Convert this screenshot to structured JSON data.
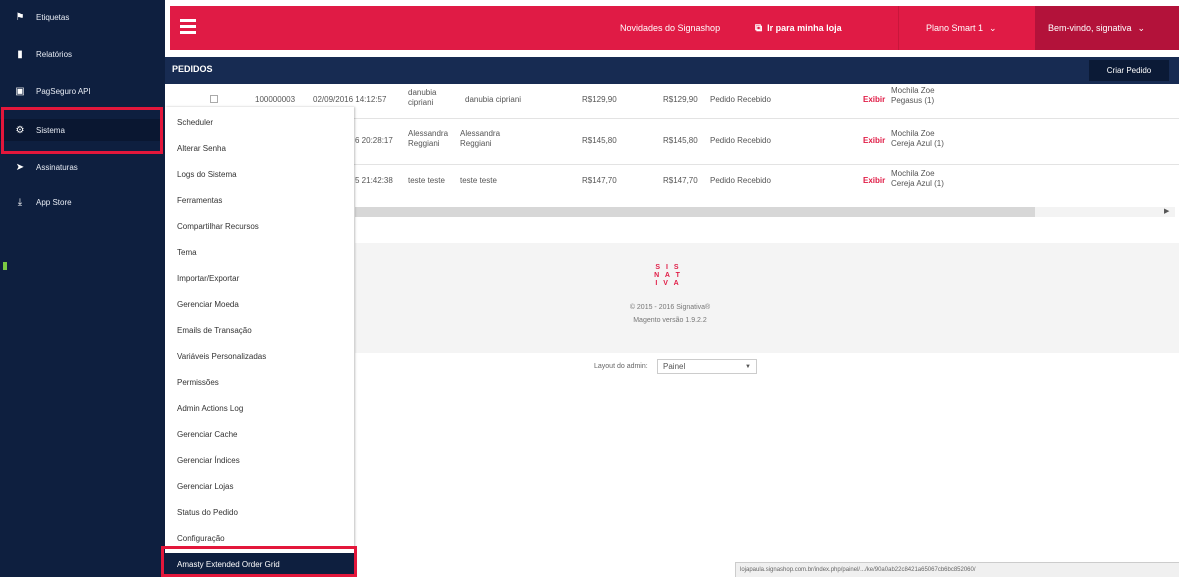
{
  "sidebar": {
    "items": [
      {
        "label": "Etiquetas",
        "icon": "bookmark-icon"
      },
      {
        "label": "Relatórios",
        "icon": "bar-chart-icon"
      },
      {
        "label": "PagSeguro API",
        "icon": "credit-card-icon"
      },
      {
        "label": "Sistema",
        "icon": "gear-icon"
      },
      {
        "label": "Assinaturas",
        "icon": "send-icon"
      },
      {
        "label": "App Store",
        "icon": "download-icon"
      }
    ]
  },
  "topbar": {
    "news": "Novidades do Signashop",
    "store": "Ir para minha loja",
    "plan": "Plano Smart 1",
    "welcome": "Bem-vindo, signativa"
  },
  "title": {
    "text": "PEDIDOS",
    "create_button": "Criar Pedido"
  },
  "orders": {
    "rows": [
      {
        "order_no": "100000003",
        "date": "02/09/2016 14:12:57",
        "bill_name": "danubia cipriani",
        "ship_name": "danubia cipriani",
        "base_total": "R$129,90",
        "purchased_total": "R$129,90",
        "status": "Pedido Recebido",
        "action": "Exibir",
        "product": "Mochila Zoe Pegasus (1)"
      },
      {
        "order_no": "",
        "date": "6 20:28:17",
        "bill_name": "Alessandra Reggiani",
        "ship_name": "Alessandra Reggiani",
        "base_total": "R$145,80",
        "purchased_total": "R$145,80",
        "status": "Pedido Recebido",
        "action": "Exibir",
        "product": "Mochila Zoe Cereja Azul (1)"
      },
      {
        "order_no": "",
        "date": "5 21:42:38",
        "bill_name": "teste teste",
        "ship_name": "teste teste",
        "base_total": "R$147,70",
        "purchased_total": "R$147,70",
        "status": "Pedido Recebido",
        "action": "Exibir",
        "product": "Mochila Zoe Cereja Azul (1)"
      }
    ]
  },
  "footer": {
    "logo": "S I S\nN A T\nI V A",
    "copyright": "© 2015 - 2016 Signativa®",
    "magento": "Magento versão 1.9.2.2",
    "layout_label": "Layout do admin:",
    "layout_value": "Painel"
  },
  "menu": {
    "items": [
      "Scheduler",
      "Alterar Senha",
      "Logs do Sistema",
      "Ferramentas",
      "Compartilhar Recursos",
      "Tema",
      "Importar/Exportar",
      "Gerenciar Moeda",
      "Emails de Transação",
      "Variáveis Personalizadas",
      "Permissões",
      "Admin Actions Log",
      "Gerenciar Cache",
      "Gerenciar Índices",
      "Gerenciar Lojas",
      "Status do Pedido",
      "Configuração",
      "Amasty Extended Order Grid"
    ]
  },
  "status_url": "lojapaula.signashop.com.br/index.php/painel/.../ke/90a0ab22c8421a65067cb6bc852060/",
  "colors": {
    "brand_red": "#e01b45",
    "navy": "#0e1f3f",
    "title_bar": "#172b52",
    "highlight": "#e3173b"
  }
}
